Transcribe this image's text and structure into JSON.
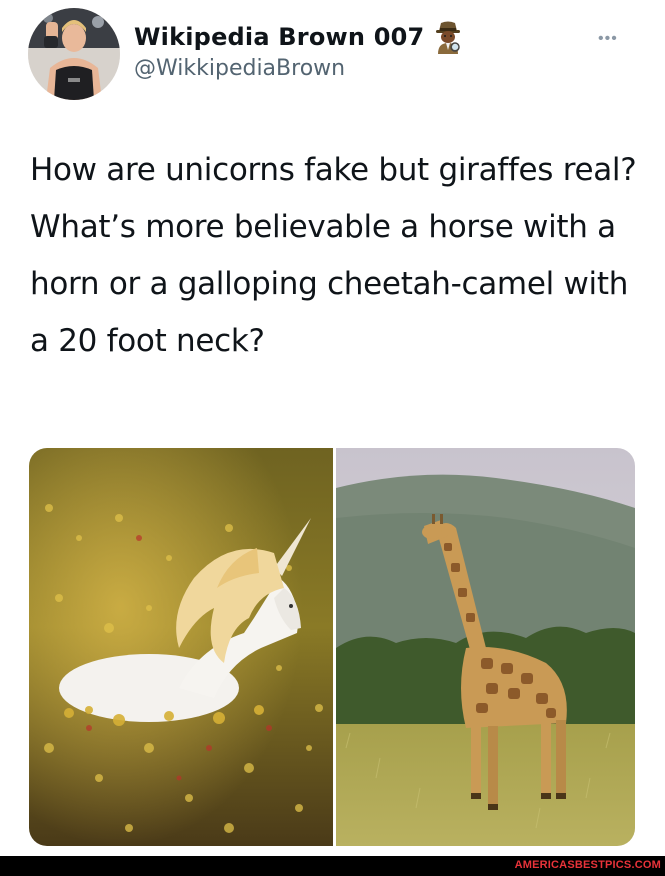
{
  "tweet": {
    "author": {
      "display_name": "Wikipedia Brown 007",
      "handle": "@WikkipediaBrown",
      "name_emoji": "detective-emoji"
    },
    "more_label": "•••",
    "text_lines": [
      "How are unicorns fake but giraffes real?",
      "What’s more believable a horse with a horn or a galloping cheetah-camel with a 20 foot neck?"
    ],
    "media": [
      {
        "subject": "unicorn-in-flower-field-photo"
      },
      {
        "subject": "giraffe-in-savanna-photo"
      }
    ]
  },
  "watermark": {
    "text": "AMERICASBESTPICS.COM"
  },
  "colors": {
    "text": "#0f1419",
    "handle": "#536471",
    "watermark": "#e8333a",
    "footer_bg": "#000000"
  }
}
